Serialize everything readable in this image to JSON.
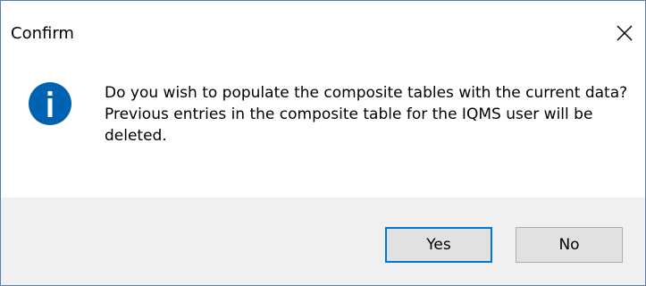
{
  "window": {
    "title": "Confirm",
    "close_icon": "close-icon"
  },
  "message": {
    "icon": "info-icon",
    "icon_color": "#0063b1",
    "line1": "Do you wish to populate the composite tables with the current data?",
    "line2": "Previous entries in the composite table for the IQMS user will be deleted."
  },
  "buttons": {
    "yes_label": "Yes",
    "no_label": "No",
    "default_border_color": "#0078d7"
  }
}
